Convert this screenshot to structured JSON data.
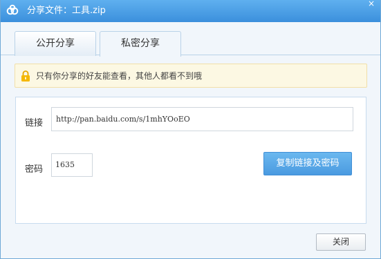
{
  "titlebar": {
    "title": "分享文件：工具.zip",
    "logo_icon": "baidu-cloud-logo-icon",
    "close_glyph": "×"
  },
  "tabs": [
    {
      "label": "公开分享",
      "active": false
    },
    {
      "label": "私密分享",
      "active": true
    }
  ],
  "notice": {
    "text": "只有你分享的好友能查看，其他人都看不到哦",
    "icon": "lock-icon"
  },
  "form": {
    "link_label": "链接",
    "link_value": "http://pan.baidu.com/s/1mhYOoEO",
    "password_label": "密码",
    "password_value": "1635",
    "copy_button": "复制链接及密码"
  },
  "footer": {
    "close_button": "关闭"
  },
  "colors": {
    "titlebar": "#3b8fdc",
    "accent": "#4a9ae0",
    "notice_bg": "#fcf8e3"
  }
}
